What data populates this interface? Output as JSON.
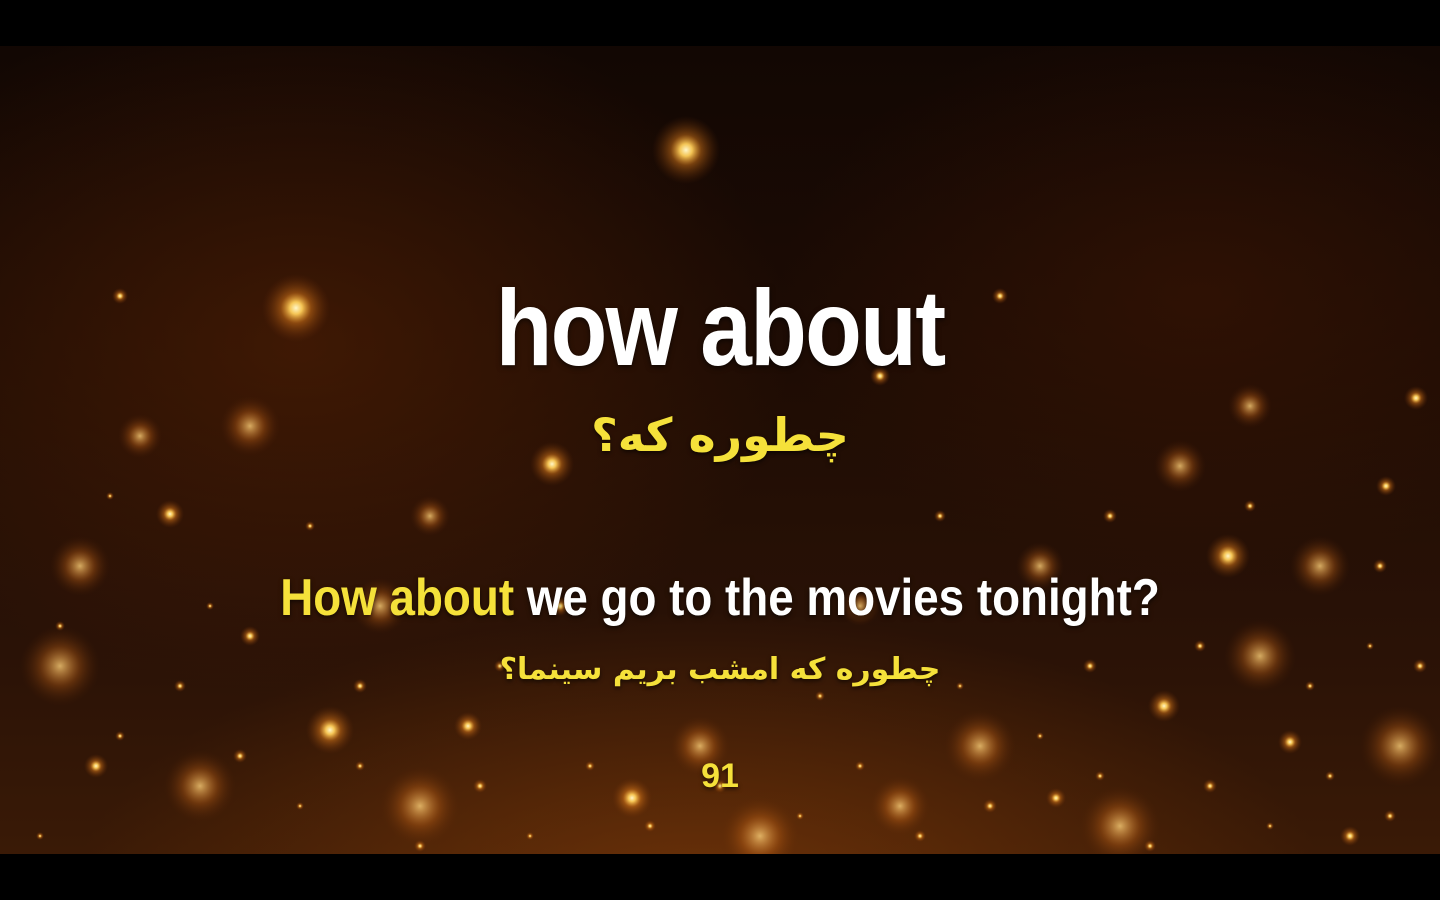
{
  "background": {
    "theme": "glowing-bokeh-particles",
    "base_color": "#1e0c04",
    "glow_color": "#ffb43c",
    "letterbox_color": "#000000"
  },
  "card": {
    "headword": "how about",
    "headword_translation": "چطوره که؟",
    "example_highlight": "How about",
    "example_rest": " we go to the movies tonight?",
    "example_translation": "چطوره که امشب بریم سینما؟",
    "number": "91"
  },
  "colors": {
    "headword": "#ffffff",
    "accent": "#f5e13a",
    "example_text": "#ffffff"
  }
}
